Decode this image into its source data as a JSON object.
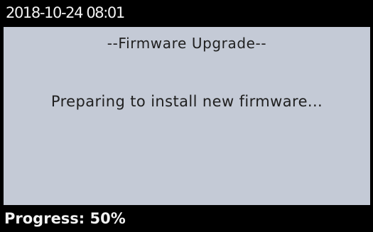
{
  "status_bar": {
    "datetime": "2018-10-24 08:01"
  },
  "dialog": {
    "title": "--Firmware Upgrade--",
    "message": "Preparing to install new firmware..."
  },
  "footer": {
    "progress_text": "Progress: 50%",
    "progress_percent": 50
  },
  "colors": {
    "screen_background": "#000000",
    "panel_background": "#c4cad6",
    "primary_text": "#202020",
    "bar_text": "#f2f2f2"
  }
}
